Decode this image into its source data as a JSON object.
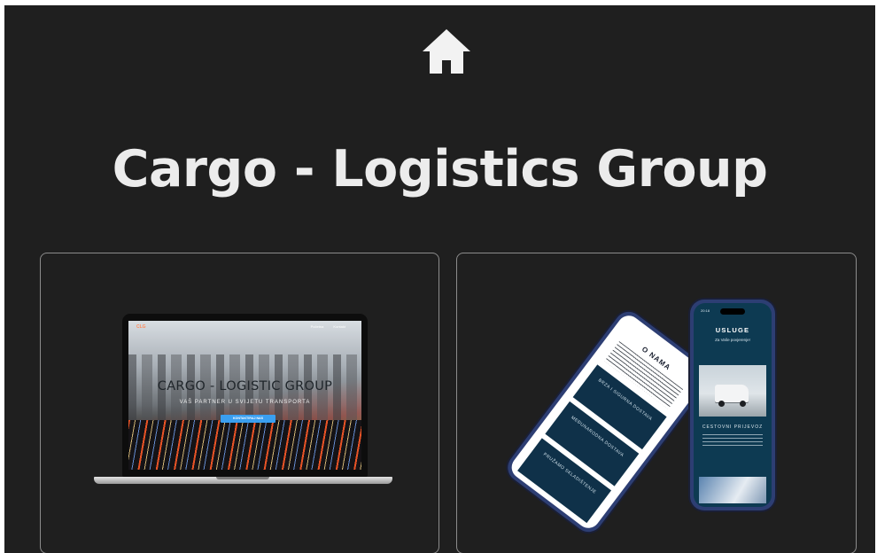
{
  "header": {
    "home_icon": "home-icon",
    "title": "Cargo - Logistics Group"
  },
  "laptop_mockup": {
    "brand": "CLG",
    "nav": [
      "Početna",
      "Kontakt"
    ],
    "heading": "CARGO - LOGISTIC GROUP",
    "subheading": "VAŠ PARTNER U SVIJETU TRANSPORTA",
    "button": "KONTAKTIRAJ NAS"
  },
  "phone_mockup_left": {
    "title": "O NAMA",
    "tiles": [
      "BRZA I SIGURNA DOSTAVA",
      "MEĐUNARODNA DOSTAVA",
      "PRUŽAMO SKLADIŠTENJE"
    ]
  },
  "phone_mockup_right": {
    "time": "20:18",
    "title": "USLUGE",
    "subtitle": "Za Vaše povjerenje!",
    "section": "CESTOVNI PRIJEVOZ"
  },
  "colors": {
    "page_bg": "#1f1f1f",
    "title": "#ececec",
    "card_border": "#8c8c8c",
    "accent": "#3a9ff0",
    "phone_tile": "#0f3149"
  }
}
